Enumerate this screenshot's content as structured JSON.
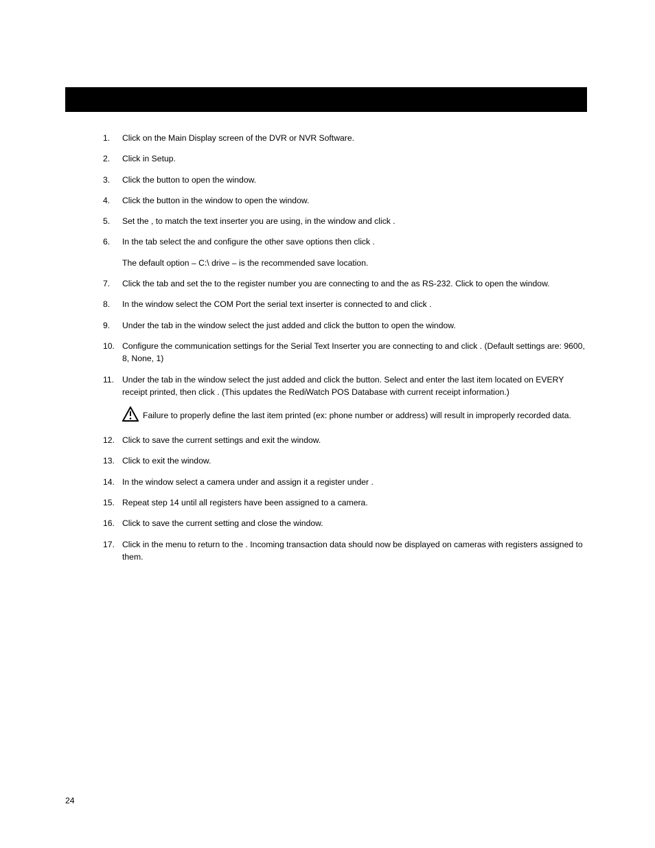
{
  "pageNumber": "24",
  "steps": {
    "s1": {
      "n": "1.",
      "t": "Click          on the Main Display screen of the DVR or NVR Software."
    },
    "s2": {
      "n": "2.",
      "t": "Click             in Setup."
    },
    "s3": {
      "n": "3.",
      "t": "Click the                    button to open the                     window."
    },
    "s4": {
      "n": "4.",
      "t": "Click the                               button in the                     window to open the                                            window."
    },
    "s5": {
      "n": "5.",
      "t": "Set the            , to match the text inserter you are using, in the                                           window and click          ."
    },
    "s6": {
      "n": "6.",
      "t": "In the           tab select the                           and configure the other save options then click          ."
    },
    "s6b": {
      "t": "The default option – C:\\ drive – is the recommended save location."
    },
    "s7": {
      "n": "7.",
      "t": "Click the                               tab and set the                to the register number you are connecting to and the           as RS-232. Click          to open the               window."
    },
    "s8": {
      "n": "8.",
      "t": "In the               window select the COM Port the serial text inserter is connected to and click          ."
    },
    "s9": {
      "n": "9.",
      "t": "Under the                               tab in the                window select the              just added and click the                  button to open the                        window."
    },
    "s10": {
      "n": "10.",
      "t": "Configure the communication settings for the Serial Text Inserter you are connecting to and click          . (Default settings are: 9600, 8, None, 1)"
    },
    "s11": {
      "n": "11.",
      "t": "Under the                               tab in the                window select the              just added and click the               button.  Select               and enter the last item located on EVERY receipt printed, then click          .  (This updates the RediWatch POS Database with current receipt information.)"
    },
    "caution": "Failure to properly define the last item printed (ex: phone number or address) will result in improperly recorded data.",
    "s12": {
      "n": "12.",
      "t": "Click          to save the current settings and exit the                     window."
    },
    "s13": {
      "n": "13.",
      "t": "Click          to exit the                                             window."
    },
    "s14": {
      "n": "14.",
      "t": "In the                    window select a camera under                   and assign it a register under              ."
    },
    "s15": {
      "n": "15.",
      "t": "Repeat step 14 until all registers have been assigned to a camera."
    },
    "s16": {
      "n": "16.",
      "t": "Click          to save the current setting and close the                    window."
    },
    "s17": {
      "n": "17.",
      "t": "Click          in the               menu to return to the                       .  Incoming transaction data should now be displayed on cameras with registers assigned to them."
    }
  }
}
